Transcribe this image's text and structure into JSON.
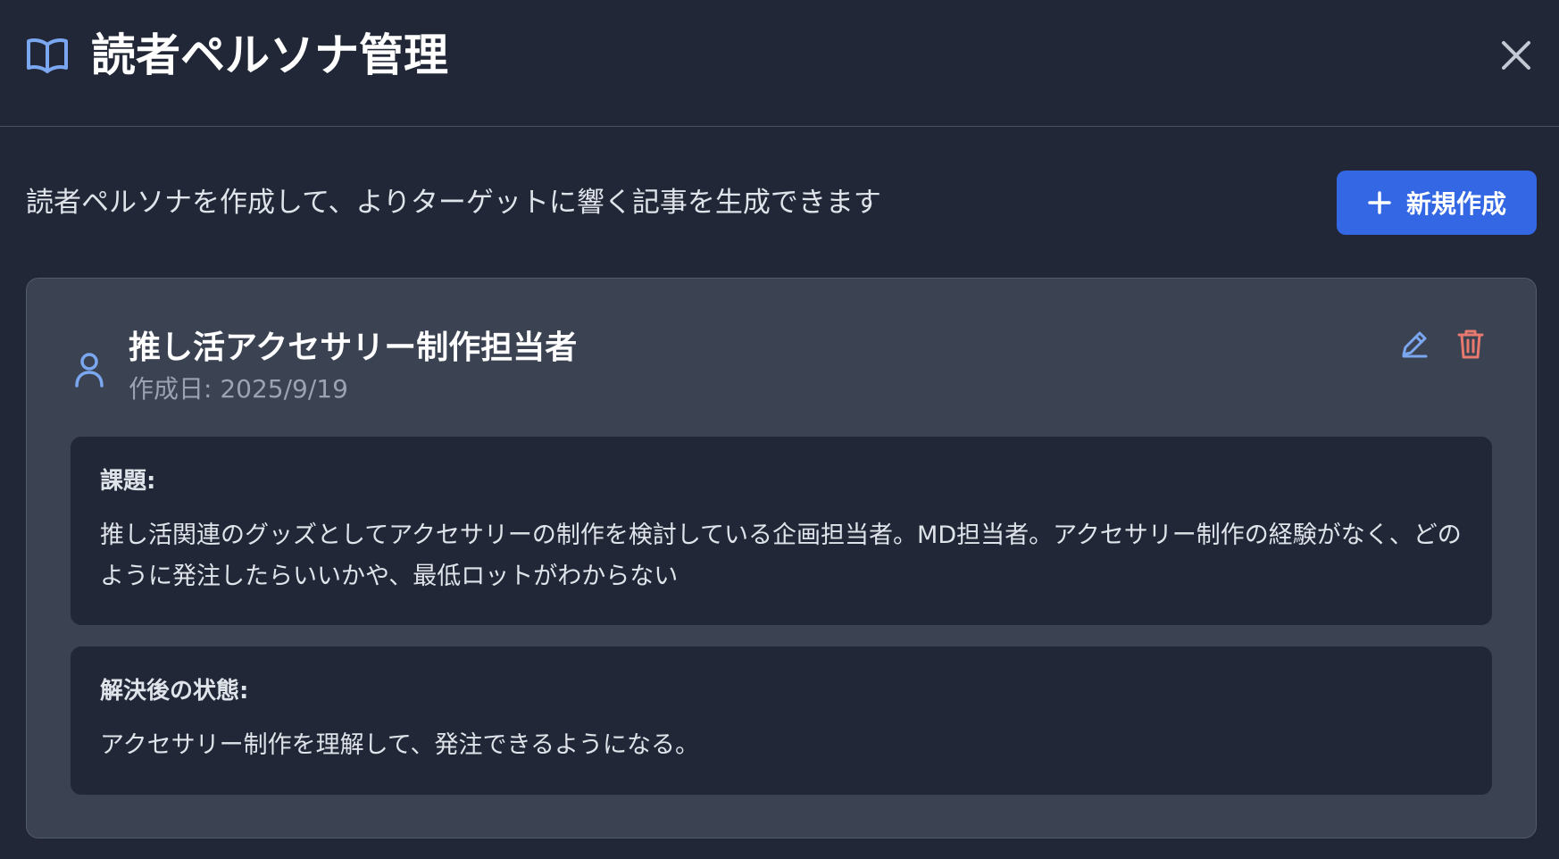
{
  "header": {
    "title": "読者ペルソナ管理",
    "title_icon": "book-open-icon",
    "close_icon": "close-icon"
  },
  "main": {
    "description": "読者ペルソナを作成して、よりターゲットに響く記事を生成できます",
    "new_button": {
      "label": "新規作成",
      "icon": "plus-icon"
    }
  },
  "persona": {
    "name": "推し活アクセサリー制作担当者",
    "created": "作成日: 2025/9/19",
    "icon": "user-icon",
    "edit_icon": "pencil-icon",
    "delete_icon": "trash-icon",
    "challenge": {
      "label": "課題:",
      "text": "推し活関連のグッズとしてアクセサリーの制作を検討している企画担当者。MD担当者。アクセサリー制作の経験がなく、どのように発注したらいいかや、最低ロットがわからない"
    },
    "outcome": {
      "label": "解決後の状態:",
      "text": "アクセサリー制作を理解して、発注できるようになる。"
    }
  },
  "colors": {
    "background": "#212736",
    "card": "#3b4252",
    "accent": "#3367e3",
    "icon_blue": "#7aa7f0",
    "delete_red": "#e8796f"
  }
}
